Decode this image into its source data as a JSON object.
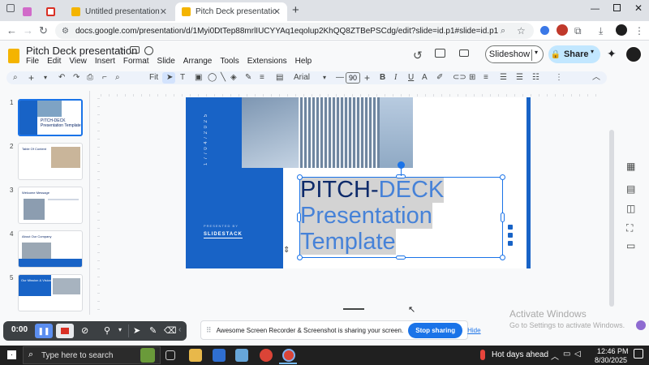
{
  "browser": {
    "tabs": [
      {
        "title": ""
      },
      {
        "title": ""
      },
      {
        "title": "Untitled presentation - Google"
      },
      {
        "title": "Pitch Deck presentation - Goog"
      }
    ],
    "new_tab_glyph": "+",
    "url": "docs.google.com/presentation/d/1Myi0DtTep88mrlIUCYYAq1eqolup2KhQQ8ZTBePSCdg/edit?slide=id.p1#slide=id.p1"
  },
  "doc": {
    "title": "Pitch Deck presentation",
    "menu": [
      "File",
      "Edit",
      "View",
      "Insert",
      "Format",
      "Slide",
      "Arrange",
      "Tools",
      "Extensions",
      "Help"
    ],
    "slideshow_label": "Slideshow",
    "share_label": "Share"
  },
  "toolbar": {
    "zoom_label": "Fit",
    "font_name": "Arial",
    "font_size": "90",
    "minus": "—",
    "plus": "+",
    "bold": "B",
    "italic": "I",
    "underline": "U",
    "font_color_glyph": "A"
  },
  "filmstrip": {
    "numbers": [
      "1",
      "2",
      "3",
      "4",
      "5"
    ],
    "thumb_titles": [
      "PITCH-DECK Presentation Template",
      "Table Of Content",
      "Welcome Message",
      "About Our Company",
      "Our Mission & Vision"
    ]
  },
  "slide": {
    "date_text": "1 7 / 0 4 / 2 0 2 5",
    "presented_by": "PRESENTED BY",
    "company": "SLIDESTACK",
    "title_line1_a": "PITCH-",
    "title_line1_b": "DECK",
    "title_line2": "Presentation",
    "title_line3": "Template",
    "colors": {
      "navy": "#0d2a6a",
      "blue": "#1863c6",
      "accent": "#4682d8",
      "selection": "#d3d3d3"
    }
  },
  "watermark": {
    "line1": "Activate Windows",
    "line2": "Go to Settings to activate Windows."
  },
  "recorder": {
    "timer": "0:00"
  },
  "share_notice": {
    "text": "Awesome Screen Recorder & Screenshot is sharing your screen.",
    "stop_label": "Stop sharing",
    "hide_label": "Hide"
  },
  "taskbar": {
    "search_placeholder": "Type here to search",
    "weather": "Hot days ahead",
    "time": "12:46 PM",
    "date": "8/30/2025"
  },
  "zoom_badge": "0.00"
}
